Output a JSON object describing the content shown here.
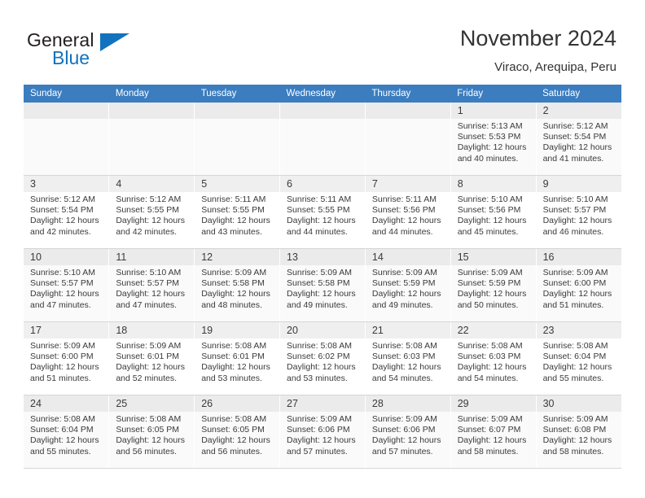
{
  "brand": {
    "word_one": "General",
    "word_two": "Blue",
    "flag_icon": "triangle-flag-icon",
    "colors": {
      "blue": "#1272bd",
      "dark": "#231f20"
    }
  },
  "header": {
    "title": "November 2024",
    "subtitle": "Viraco, Arequipa, Peru"
  },
  "calendar": {
    "accent_color": "#3b7dbf",
    "weekday_headers": [
      "Sunday",
      "Monday",
      "Tuesday",
      "Wednesday",
      "Thursday",
      "Friday",
      "Saturday"
    ],
    "weeks": [
      [
        {
          "empty": true
        },
        {
          "empty": true
        },
        {
          "empty": true
        },
        {
          "empty": true
        },
        {
          "empty": true
        },
        {
          "day": "1",
          "sunrise": "Sunrise: 5:13 AM",
          "sunset": "Sunset: 5:53 PM",
          "daylight_line1": "Daylight: 12 hours",
          "daylight_line2": "and 40 minutes."
        },
        {
          "day": "2",
          "sunrise": "Sunrise: 5:12 AM",
          "sunset": "Sunset: 5:54 PM",
          "daylight_line1": "Daylight: 12 hours",
          "daylight_line2": "and 41 minutes."
        }
      ],
      [
        {
          "day": "3",
          "sunrise": "Sunrise: 5:12 AM",
          "sunset": "Sunset: 5:54 PM",
          "daylight_line1": "Daylight: 12 hours",
          "daylight_line2": "and 42 minutes."
        },
        {
          "day": "4",
          "sunrise": "Sunrise: 5:12 AM",
          "sunset": "Sunset: 5:55 PM",
          "daylight_line1": "Daylight: 12 hours",
          "daylight_line2": "and 42 minutes."
        },
        {
          "day": "5",
          "sunrise": "Sunrise: 5:11 AM",
          "sunset": "Sunset: 5:55 PM",
          "daylight_line1": "Daylight: 12 hours",
          "daylight_line2": "and 43 minutes."
        },
        {
          "day": "6",
          "sunrise": "Sunrise: 5:11 AM",
          "sunset": "Sunset: 5:55 PM",
          "daylight_line1": "Daylight: 12 hours",
          "daylight_line2": "and 44 minutes."
        },
        {
          "day": "7",
          "sunrise": "Sunrise: 5:11 AM",
          "sunset": "Sunset: 5:56 PM",
          "daylight_line1": "Daylight: 12 hours",
          "daylight_line2": "and 44 minutes."
        },
        {
          "day": "8",
          "sunrise": "Sunrise: 5:10 AM",
          "sunset": "Sunset: 5:56 PM",
          "daylight_line1": "Daylight: 12 hours",
          "daylight_line2": "and 45 minutes."
        },
        {
          "day": "9",
          "sunrise": "Sunrise: 5:10 AM",
          "sunset": "Sunset: 5:57 PM",
          "daylight_line1": "Daylight: 12 hours",
          "daylight_line2": "and 46 minutes."
        }
      ],
      [
        {
          "day": "10",
          "sunrise": "Sunrise: 5:10 AM",
          "sunset": "Sunset: 5:57 PM",
          "daylight_line1": "Daylight: 12 hours",
          "daylight_line2": "and 47 minutes."
        },
        {
          "day": "11",
          "sunrise": "Sunrise: 5:10 AM",
          "sunset": "Sunset: 5:57 PM",
          "daylight_line1": "Daylight: 12 hours",
          "daylight_line2": "and 47 minutes."
        },
        {
          "day": "12",
          "sunrise": "Sunrise: 5:09 AM",
          "sunset": "Sunset: 5:58 PM",
          "daylight_line1": "Daylight: 12 hours",
          "daylight_line2": "and 48 minutes."
        },
        {
          "day": "13",
          "sunrise": "Sunrise: 5:09 AM",
          "sunset": "Sunset: 5:58 PM",
          "daylight_line1": "Daylight: 12 hours",
          "daylight_line2": "and 49 minutes."
        },
        {
          "day": "14",
          "sunrise": "Sunrise: 5:09 AM",
          "sunset": "Sunset: 5:59 PM",
          "daylight_line1": "Daylight: 12 hours",
          "daylight_line2": "and 49 minutes."
        },
        {
          "day": "15",
          "sunrise": "Sunrise: 5:09 AM",
          "sunset": "Sunset: 5:59 PM",
          "daylight_line1": "Daylight: 12 hours",
          "daylight_line2": "and 50 minutes."
        },
        {
          "day": "16",
          "sunrise": "Sunrise: 5:09 AM",
          "sunset": "Sunset: 6:00 PM",
          "daylight_line1": "Daylight: 12 hours",
          "daylight_line2": "and 51 minutes."
        }
      ],
      [
        {
          "day": "17",
          "sunrise": "Sunrise: 5:09 AM",
          "sunset": "Sunset: 6:00 PM",
          "daylight_line1": "Daylight: 12 hours",
          "daylight_line2": "and 51 minutes."
        },
        {
          "day": "18",
          "sunrise": "Sunrise: 5:09 AM",
          "sunset": "Sunset: 6:01 PM",
          "daylight_line1": "Daylight: 12 hours",
          "daylight_line2": "and 52 minutes."
        },
        {
          "day": "19",
          "sunrise": "Sunrise: 5:08 AM",
          "sunset": "Sunset: 6:01 PM",
          "daylight_line1": "Daylight: 12 hours",
          "daylight_line2": "and 53 minutes."
        },
        {
          "day": "20",
          "sunrise": "Sunrise: 5:08 AM",
          "sunset": "Sunset: 6:02 PM",
          "daylight_line1": "Daylight: 12 hours",
          "daylight_line2": "and 53 minutes."
        },
        {
          "day": "21",
          "sunrise": "Sunrise: 5:08 AM",
          "sunset": "Sunset: 6:03 PM",
          "daylight_line1": "Daylight: 12 hours",
          "daylight_line2": "and 54 minutes."
        },
        {
          "day": "22",
          "sunrise": "Sunrise: 5:08 AM",
          "sunset": "Sunset: 6:03 PM",
          "daylight_line1": "Daylight: 12 hours",
          "daylight_line2": "and 54 minutes."
        },
        {
          "day": "23",
          "sunrise": "Sunrise: 5:08 AM",
          "sunset": "Sunset: 6:04 PM",
          "daylight_line1": "Daylight: 12 hours",
          "daylight_line2": "and 55 minutes."
        }
      ],
      [
        {
          "day": "24",
          "sunrise": "Sunrise: 5:08 AM",
          "sunset": "Sunset: 6:04 PM",
          "daylight_line1": "Daylight: 12 hours",
          "daylight_line2": "and 55 minutes."
        },
        {
          "day": "25",
          "sunrise": "Sunrise: 5:08 AM",
          "sunset": "Sunset: 6:05 PM",
          "daylight_line1": "Daylight: 12 hours",
          "daylight_line2": "and 56 minutes."
        },
        {
          "day": "26",
          "sunrise": "Sunrise: 5:08 AM",
          "sunset": "Sunset: 6:05 PM",
          "daylight_line1": "Daylight: 12 hours",
          "daylight_line2": "and 56 minutes."
        },
        {
          "day": "27",
          "sunrise": "Sunrise: 5:09 AM",
          "sunset": "Sunset: 6:06 PM",
          "daylight_line1": "Daylight: 12 hours",
          "daylight_line2": "and 57 minutes."
        },
        {
          "day": "28",
          "sunrise": "Sunrise: 5:09 AM",
          "sunset": "Sunset: 6:06 PM",
          "daylight_line1": "Daylight: 12 hours",
          "daylight_line2": "and 57 minutes."
        },
        {
          "day": "29",
          "sunrise": "Sunrise: 5:09 AM",
          "sunset": "Sunset: 6:07 PM",
          "daylight_line1": "Daylight: 12 hours",
          "daylight_line2": "and 58 minutes."
        },
        {
          "day": "30",
          "sunrise": "Sunrise: 5:09 AM",
          "sunset": "Sunset: 6:08 PM",
          "daylight_line1": "Daylight: 12 hours",
          "daylight_line2": "and 58 minutes."
        }
      ]
    ]
  }
}
